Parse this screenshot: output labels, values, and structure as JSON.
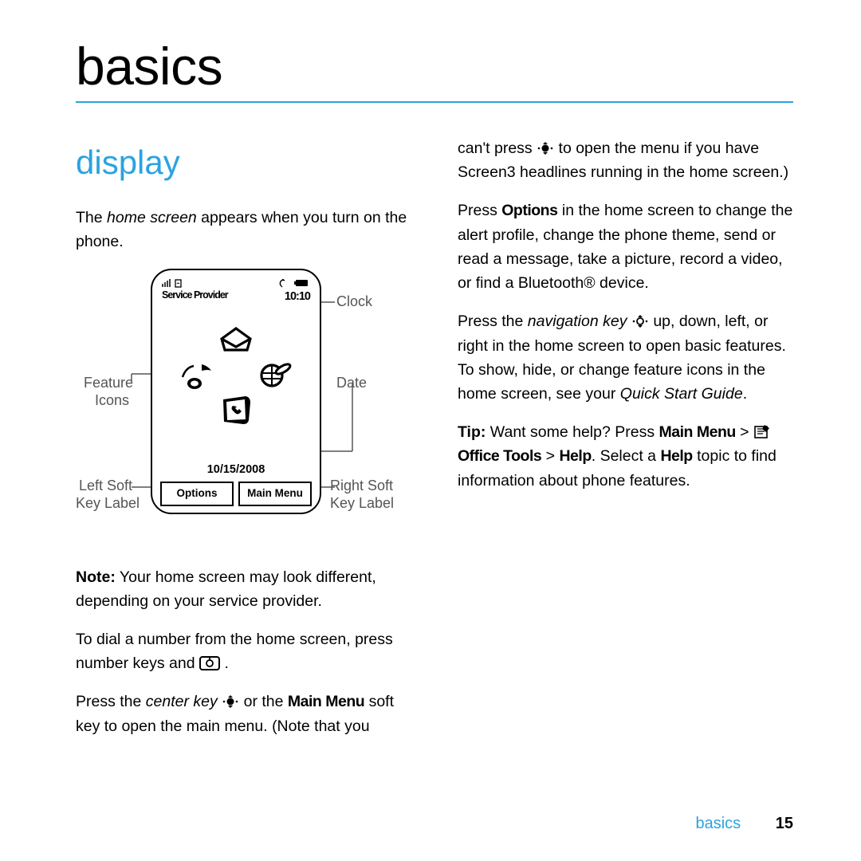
{
  "page": {
    "title": "basics",
    "section_footer": "basics",
    "number": "15"
  },
  "section": {
    "title": "display"
  },
  "left": {
    "p1a": "The ",
    "p1b": "home screen",
    "p1c": " appears when you turn on the phone.",
    "note_label": "Note:",
    "note_text": " Your home screen may look different, depending on your service provider.",
    "p2": "To dial a number from the home screen, press number keys and ",
    "p3a": "Press the ",
    "p3b": "center key",
    "p3c": " or the ",
    "p3d": "Main Menu",
    "p3e": " soft key to open the main menu. (Note that you "
  },
  "right": {
    "cont": "can't press ",
    "cont2": " to open the menu if you have Screen3 headlines running in the home screen.)",
    "p1a": "Press ",
    "p1b": "Options",
    "p1c": " in the home screen to change the alert profile, change the phone theme, send or read a message, take a picture, record a video, or find a Bluetooth® device.",
    "p2a": "Press the ",
    "p2b": "navigation key",
    "p2c": " up, down, left, or right in the home screen to open basic features. To show, hide, or change feature icons in the home screen, see your ",
    "p2d": "Quick Start Guide",
    "p2e": ".",
    "tip_label": "Tip:",
    "tip1": " Want some help? Press ",
    "tip2": "Main Menu",
    "tip3": " > ",
    "tip4": "Office Tools",
    "tip5": " > ",
    "tip6": "Help",
    "tip7": ". Select a ",
    "tip8": "Help",
    "tip9": " topic to find information about phone features."
  },
  "diagram": {
    "provider": "Service Provider",
    "clock": "10:10",
    "date": "10/15/2008",
    "left_soft": "Options",
    "right_soft": "Main Menu"
  },
  "labels": {
    "clock": "Clock",
    "date": "Date",
    "feature1": "Feature",
    "feature2": "Icons",
    "lsoft1": "Left Soft",
    "lsoft2": "Key Label",
    "rsoft1": "Right Soft",
    "rsoft2": "Key Label"
  }
}
